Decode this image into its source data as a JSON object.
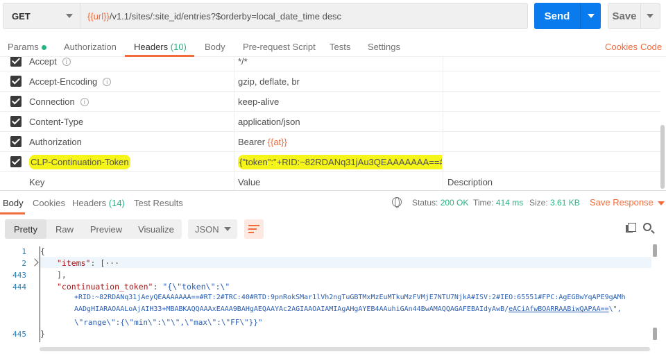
{
  "request": {
    "method": "GET",
    "url_var": "{{url}}",
    "url_path": "/v1.1/sites/:site_id/entries?$orderby=local_date_time desc",
    "send_label": "Send",
    "save_label": "Save"
  },
  "req_tabs": [
    {
      "label": "Params"
    },
    {
      "label": "Authorization"
    },
    {
      "label": "Headers",
      "count": "(10)"
    },
    {
      "label": "Body"
    },
    {
      "label": "Pre-request Script"
    },
    {
      "label": "Tests"
    },
    {
      "label": "Settings"
    }
  ],
  "req_links": {
    "cookies": "Cookies",
    "code": "Code"
  },
  "headers": [
    {
      "key": "Accept",
      "value": "*/*",
      "info": "i"
    },
    {
      "key": "Accept-Encoding",
      "value": "gzip, deflate, br",
      "info": "i"
    },
    {
      "key": "Connection",
      "value": "keep-alive",
      "info": "i"
    },
    {
      "key": "Content-Type",
      "value": "application/json"
    },
    {
      "key": "Authorization",
      "value_prefix": "Bearer ",
      "value_var": "{{at}}"
    },
    {
      "key": "CLP-Continuation-Token",
      "value": "{\"token\":\"+RID:~82RDANq31jAu3QEAAAAAAA==#RT: ..."
    }
  ],
  "headers_placeholder": {
    "key": "Key",
    "value": "Value",
    "description": "Description"
  },
  "response": {
    "tabs": [
      {
        "label": "Body"
      },
      {
        "label": "Cookies"
      },
      {
        "label": "Headers",
        "count": "(14)"
      },
      {
        "label": "Test Results"
      }
    ],
    "status_label": "Status:",
    "status_value": "200 OK",
    "time_label": "Time:",
    "time_value": "414 ms",
    "size_label": "Size:",
    "size_value": "3.61 KB",
    "save_response": "Save Response",
    "view_modes": [
      "Pretty",
      "Raw",
      "Preview",
      "Visualize"
    ],
    "format": "JSON"
  },
  "code": {
    "line_numbers": [
      "1",
      "2",
      "443",
      "444",
      "",
      "",
      "",
      "445"
    ],
    "l1": "{",
    "l2_key": "\"items\"",
    "l2_rest": ": [···",
    "l443": "],",
    "l444_key": "\"continuation_token\"",
    "l444_sep": ": ",
    "l444_val": "\"{\\\"token\\\":\\\"",
    "l444b": "+RID:~82RDANq31jAeyQEAAAAAAA==#RT:2#TRC:40#RTD:9pnRokSMar1lVh2ngTuGBTMxMzEuMTkuMzFVMjE7NTU7NjkA#ISV:2#IEO:65551#FPC:AgEGBwYqAPE9gAMh",
    "l444c_a": "AADgHIARAOAALoAjAIH33+MBABKAQQAAAxEAAA9BAHgAEQAAYAc2AGIAAOAIAMIAgAHgAYEB4AAuhiGAn44BwAMAQQAGAFEBAIdyAwB/",
    "l444c_b": "eACiAfwBOARRAABiwQAPAA==",
    "l444c_c": "\\\",",
    "l444d": "\\\"range\\\":{\\\"min\\\":\\\"\\\",\\\"max\\\":\\\"FF\\\"}}\"",
    "l445": "}"
  }
}
